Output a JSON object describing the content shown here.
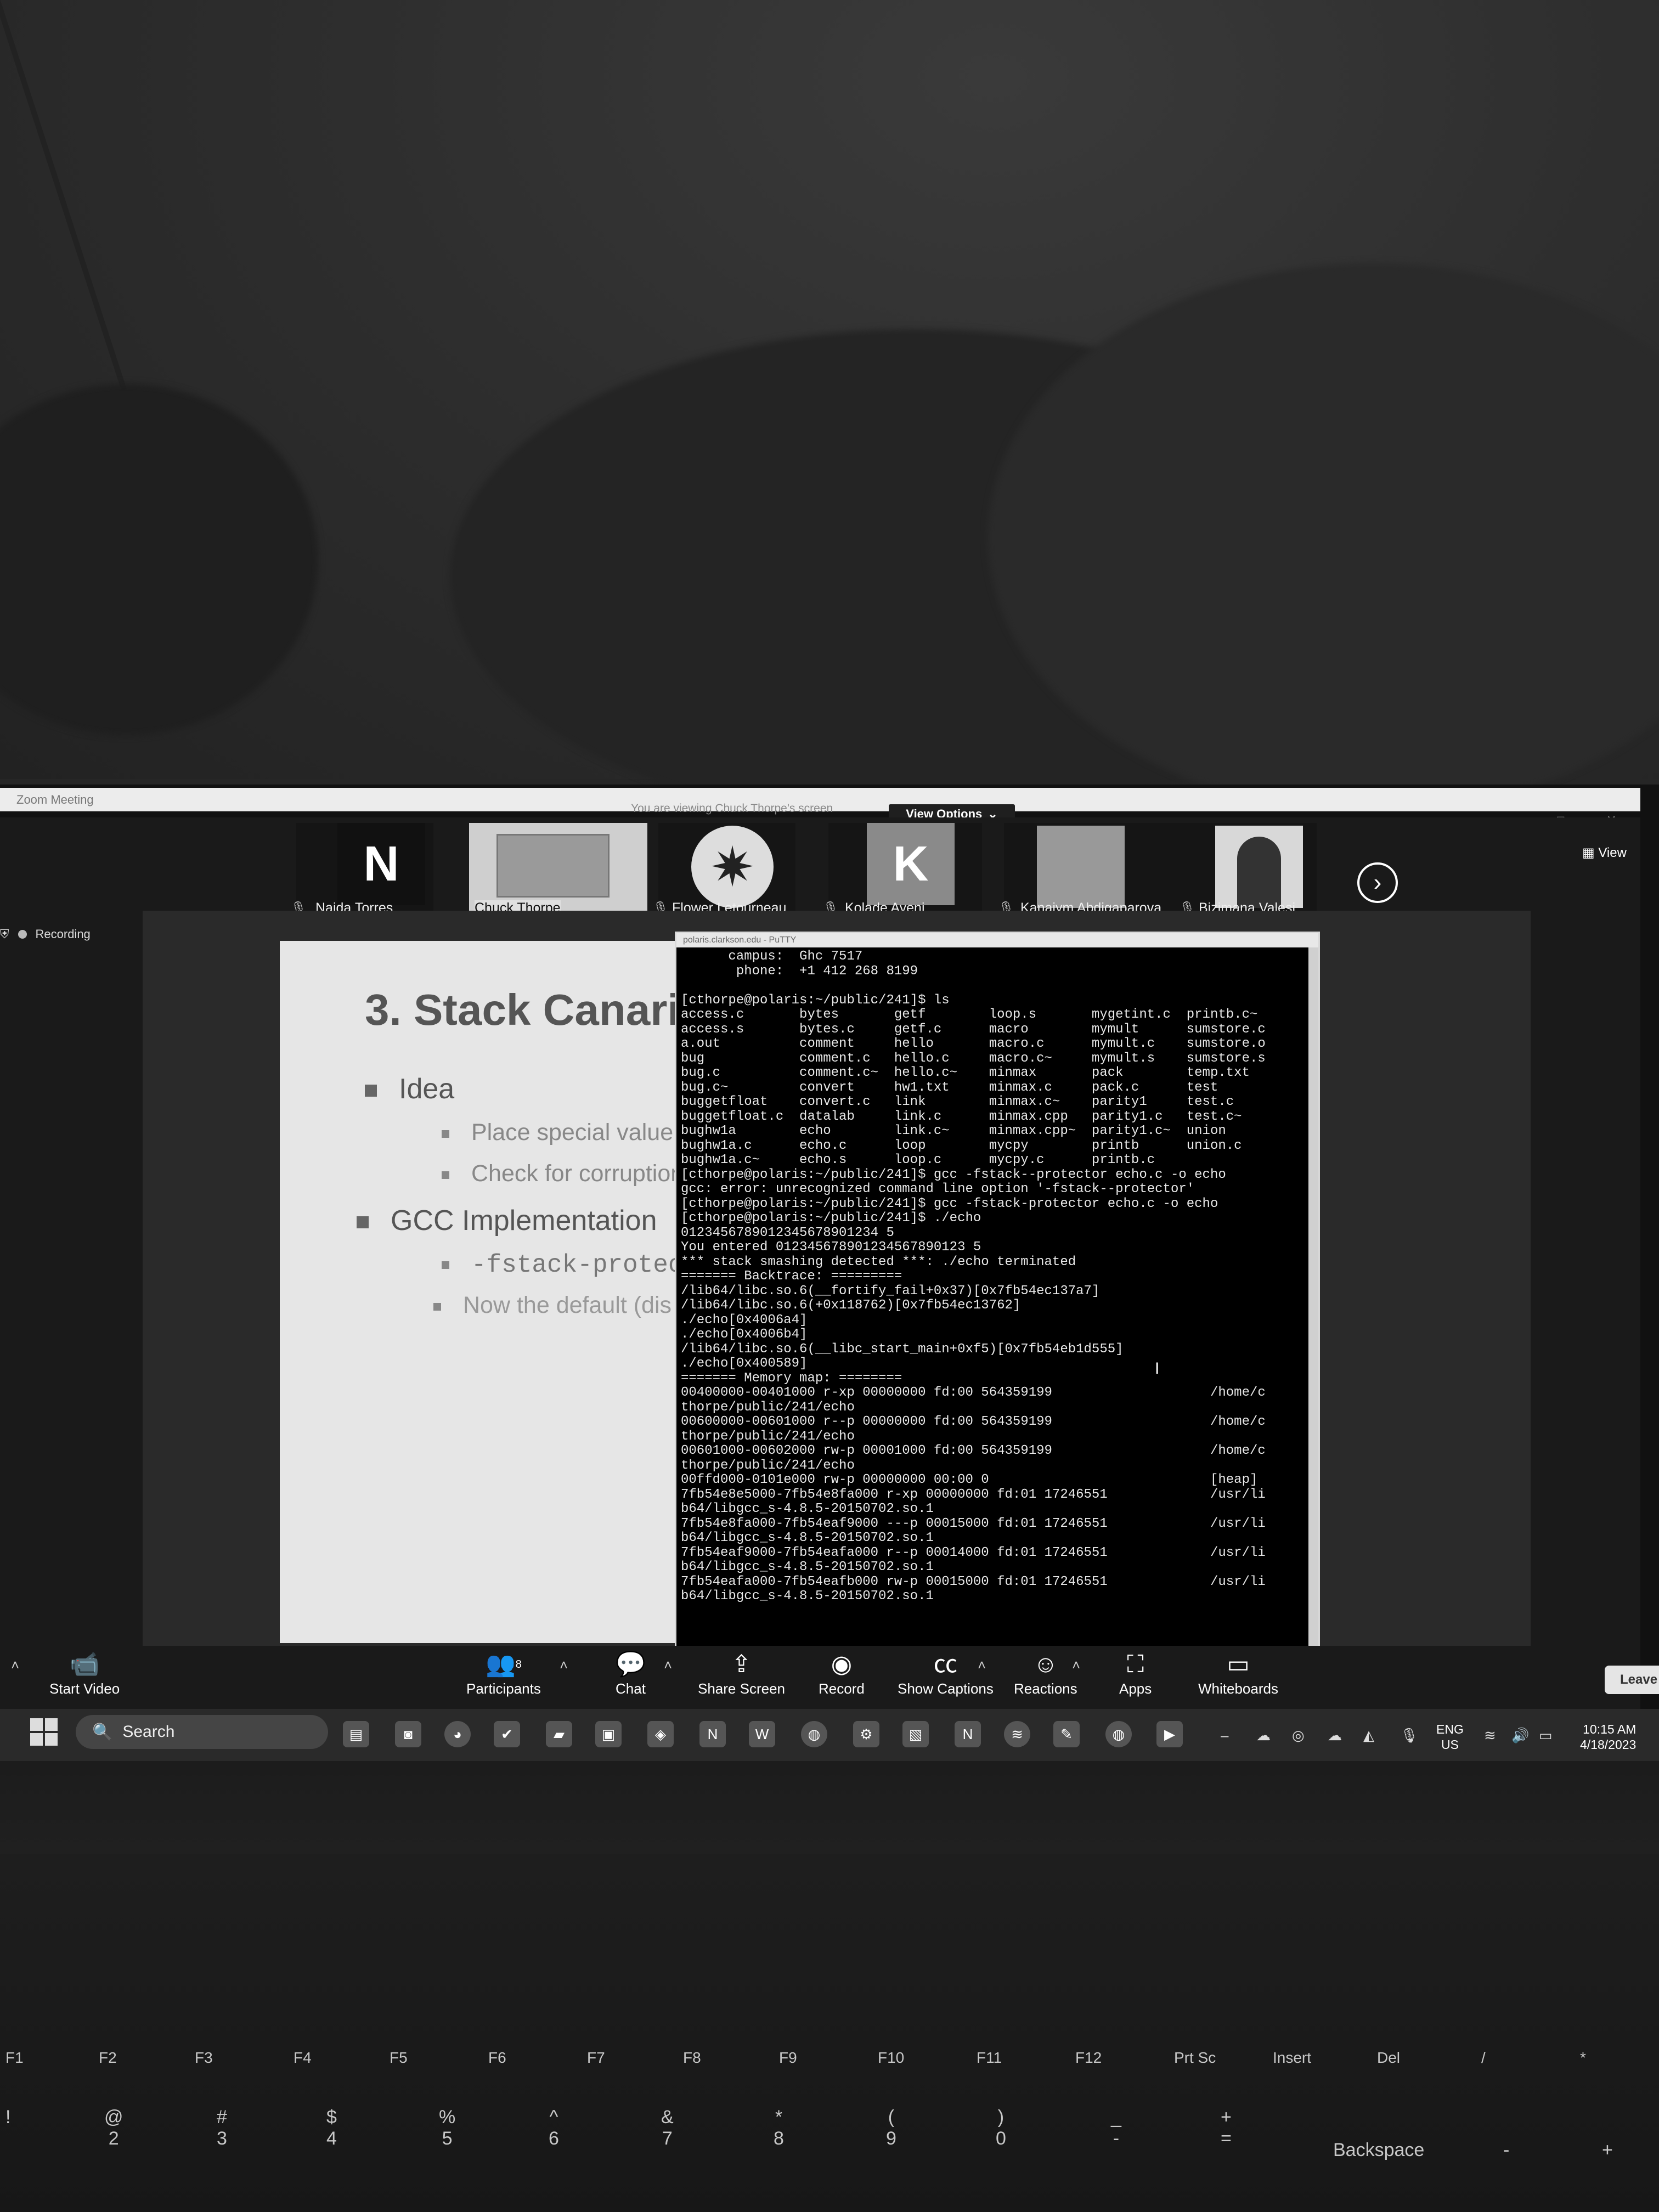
{
  "zoom": {
    "window_title": "Zoom Meeting",
    "viewing_banner": "You are viewing Chuck Thorpe's screen",
    "view_options_label": "View Options",
    "view_button_label": "View",
    "recording_label": "Recording",
    "participants": [
      {
        "name": "Naida Torres",
        "avatar_letter": "N"
      },
      {
        "name": "Chuck Thorpe",
        "avatar_letter": ""
      },
      {
        "name": "Flower Letourneau",
        "avatar_letter": ""
      },
      {
        "name": "Kolade Ayeni",
        "avatar_letter": "K"
      },
      {
        "name": "Kanaiym Abdigaparova",
        "avatar_letter": ""
      },
      {
        "name": "Bizimana Valesi",
        "avatar_letter": ""
      }
    ],
    "participants_count": "8",
    "toolbar": {
      "start_video": "Start Video",
      "participants": "Participants",
      "chat": "Chat",
      "share_screen": "Share Screen",
      "record": "Record",
      "show_captions": "Show Captions",
      "reactions": "Reactions",
      "apps": "Apps",
      "whiteboards": "Whiteboards",
      "leave": "Leave"
    }
  },
  "slide": {
    "title": "3. Stack Canarie",
    "bullet_idea": "Idea",
    "sub_place": "Place special value (",
    "sub_check": "Check for corruption",
    "bullet_gcc": "GCC Implementation",
    "sub_flag": "-fstack-protec",
    "sub_default": "Now the default (dis"
  },
  "putty": {
    "title": "polaris.clarkson.edu - PuTTY",
    "lines": [
      "      campus:  Ghc 7517",
      "       phone:  +1 412 268 8199",
      "",
      "[cthorpe@polaris:~/public/241]$ ls",
      "access.c       bytes       getf        loop.s       mygetint.c  printb.c~",
      "access.s       bytes.c     getf.c      macro        mymult      sumstore.c",
      "a.out          comment     hello       macro.c      mymult.c    sumstore.o",
      "bug            comment.c   hello.c     macro.c~     mymult.s    sumstore.s",
      "bug.c          comment.c~  hello.c~    minmax       pack        temp.txt",
      "bug.c~         convert     hw1.txt     minmax.c     pack.c      test",
      "buggetfloat    convert.c   link        minmax.c~    parity1     test.c",
      "buggetfloat.c  datalab     link.c      minmax.cpp   parity1.c   test.c~",
      "bughw1a        echo        link.c~     minmax.cpp~  parity1.c~  union",
      "bughw1a.c      echo.c      loop        mycpy        printb      union.c",
      "bughw1a.c~     echo.s      loop.c      mycpy.c      printb.c",
      "[cthorpe@polaris:~/public/241]$ gcc -fstack--protector echo.c -o echo",
      "gcc: error: unrecognized command line option '-fstack--protector'",
      "[cthorpe@polaris:~/public/241]$ gcc -fstack-protector echo.c -o echo",
      "[cthorpe@polaris:~/public/241]$ ./echo",
      "0123456789012345678901234 5",
      "You entered 012345678901234567890123 5",
      "*** stack smashing detected ***: ./echo terminated",
      "======= Backtrace: =========",
      "/lib64/libc.so.6(__fortify_fail+0x37)[0x7fb54ec137a7]",
      "/lib64/libc.so.6(+0x118762)[0x7fb54ec13762]",
      "./echo[0x4006a4]",
      "./echo[0x4006b4]",
      "/lib64/libc.so.6(__libc_start_main+0xf5)[0x7fb54eb1d555]",
      "./echo[0x400589]",
      "======= Memory map: ========",
      "00400000-00401000 r-xp 00000000 fd:00 564359199                    /home/c",
      "thorpe/public/241/echo",
      "00600000-00601000 r--p 00000000 fd:00 564359199                    /home/c",
      "thorpe/public/241/echo",
      "00601000-00602000 rw-p 00001000 fd:00 564359199                    /home/c",
      "thorpe/public/241/echo",
      "00ffd000-0101e000 rw-p 00000000 00:00 0                            [heap]",
      "7fb54e8e5000-7fb54e8fa000 r-xp 00000000 fd:01 17246551             /usr/li",
      "b64/libgcc_s-4.8.5-20150702.so.1",
      "7fb54e8fa000-7fb54eaf9000 ---p 00015000 fd:01 17246551             /usr/li",
      "b64/libgcc_s-4.8.5-20150702.so.1",
      "7fb54eaf9000-7fb54eafa000 r--p 00014000 fd:01 17246551             /usr/li",
      "b64/libgcc_s-4.8.5-20150702.so.1",
      "7fb54eafa000-7fb54eafb000 rw-p 00015000 fd:01 17246551             /usr/li",
      "b64/libgcc_s-4.8.5-20150702.so.1"
    ]
  },
  "taskbar": {
    "search_label": "Search",
    "language_line1": "ENG",
    "language_line2": "US",
    "time": "10:15 AM",
    "date": "4/18/2023"
  },
  "keyboard": {
    "fn_row": [
      "F1",
      "F2",
      "F3",
      "F4",
      "F5",
      "F6",
      "F7",
      "F8",
      "F9",
      "F10",
      "F11",
      "F12",
      "Prt Sc",
      "Insert",
      "Del",
      "/",
      "*"
    ],
    "num_row": [
      {
        "top": "!",
        "bottom": ""
      },
      {
        "top": "@",
        "bottom": "2"
      },
      {
        "top": "#",
        "bottom": "3"
      },
      {
        "top": "$",
        "bottom": "4"
      },
      {
        "top": "%",
        "bottom": "5"
      },
      {
        "top": "^",
        "bottom": "6"
      },
      {
        "top": "&",
        "bottom": "7"
      },
      {
        "top": "*",
        "bottom": "8"
      },
      {
        "top": "(",
        "bottom": "9"
      },
      {
        "top": ")",
        "bottom": "0"
      },
      {
        "top": "_",
        "bottom": "-"
      },
      {
        "top": "+",
        "bottom": "="
      }
    ],
    "backspace": "Backspace",
    "minus": "-",
    "plus": "+"
  }
}
